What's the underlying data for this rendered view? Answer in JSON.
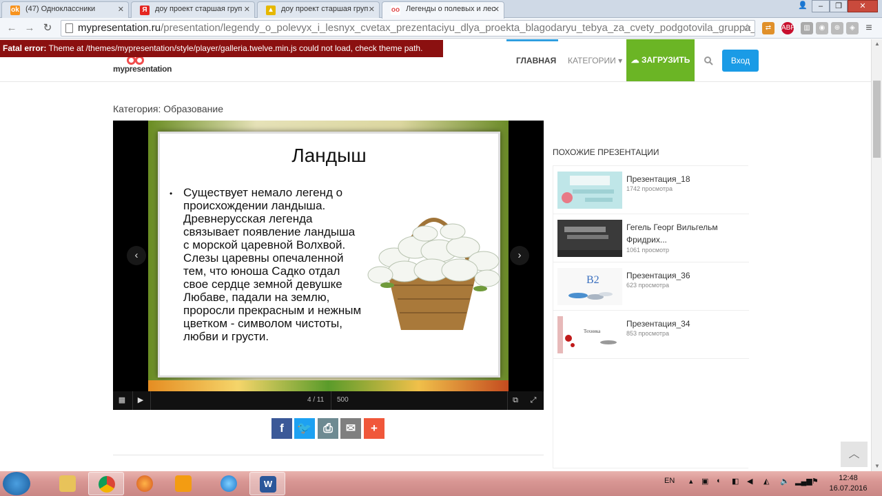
{
  "tabs": [
    {
      "label": "(47) Одноклассники",
      "fav": "ok-icon",
      "color": "#f7931e"
    },
    {
      "label": "доу проект старшая груп",
      "fav": "yandex-icon",
      "color": "#e52620"
    },
    {
      "label": "доу проект старшая груп",
      "fav": "image-icon",
      "color": "#e6b800"
    },
    {
      "label": "Легенды о полевых и лес",
      "fav": "mypresentation-icon",
      "color": "#e04848"
    }
  ],
  "address": {
    "host": "mypresentation.ru",
    "path": "/presentation/legendy_o_polevyx_i_lesnyx_cvetax_prezentaciyu_dlya_proekta_blagodaryu_tebya_za_cvety_podgotovila_gruppa_i:"
  },
  "error": {
    "prefix": "Fatal error:",
    "message": " Theme at /themes/mypresentation/style/player/galleria.twelve.min.js could not load, check theme path."
  },
  "site": {
    "logo": "mypresentation",
    "nav_main": "ГЛАВНАЯ",
    "nav_categories": "КАТЕГОРИИ",
    "upload": "ЗАГРУЗИТЬ",
    "login": "Вход",
    "category": "Категория: Образование"
  },
  "slide": {
    "title": "Ландыш",
    "bullet": "•",
    "text": "Существует немало легенд о происхождении ландыша. Древнерусская легенда связывает появление ландыша с морской царевной Волхвой. Слезы царевны опечаленной тем, что юноша Садко отдал свое сердце земной девушке Любаве, падали на землю, проросли прекрасным и нежным цветком - символом чистоты, любви и грусти."
  },
  "player": {
    "counter": "4 / 11",
    "zoom": "500"
  },
  "share": [
    {
      "name": "facebook",
      "glyph": "f",
      "color": "#3b5998"
    },
    {
      "name": "twitter",
      "glyph": "t",
      "color": "#1da1f2"
    },
    {
      "name": "print",
      "glyph": "⎙",
      "color": "#6d8a92"
    },
    {
      "name": "email",
      "glyph": "✉",
      "color": "#7f7f7f"
    },
    {
      "name": "more",
      "glyph": "+",
      "color": "#f0573a"
    }
  ],
  "similar": {
    "title": "ПОХОЖИЕ ПРЕЗЕНТАЦИИ",
    "items": [
      {
        "name": "Презентация_18",
        "views": "1742 просмотра"
      },
      {
        "name": "Гегель Георг Вильгельм Фридрих...",
        "views": "1061 просмотр"
      },
      {
        "name": "Презентация_36",
        "views": "623 просмотра"
      },
      {
        "name": "Презентация_34",
        "views": "853 просмотра"
      }
    ]
  },
  "taskbar": {
    "lang": "EN",
    "time": "12:48",
    "date": "16.07.2016"
  }
}
